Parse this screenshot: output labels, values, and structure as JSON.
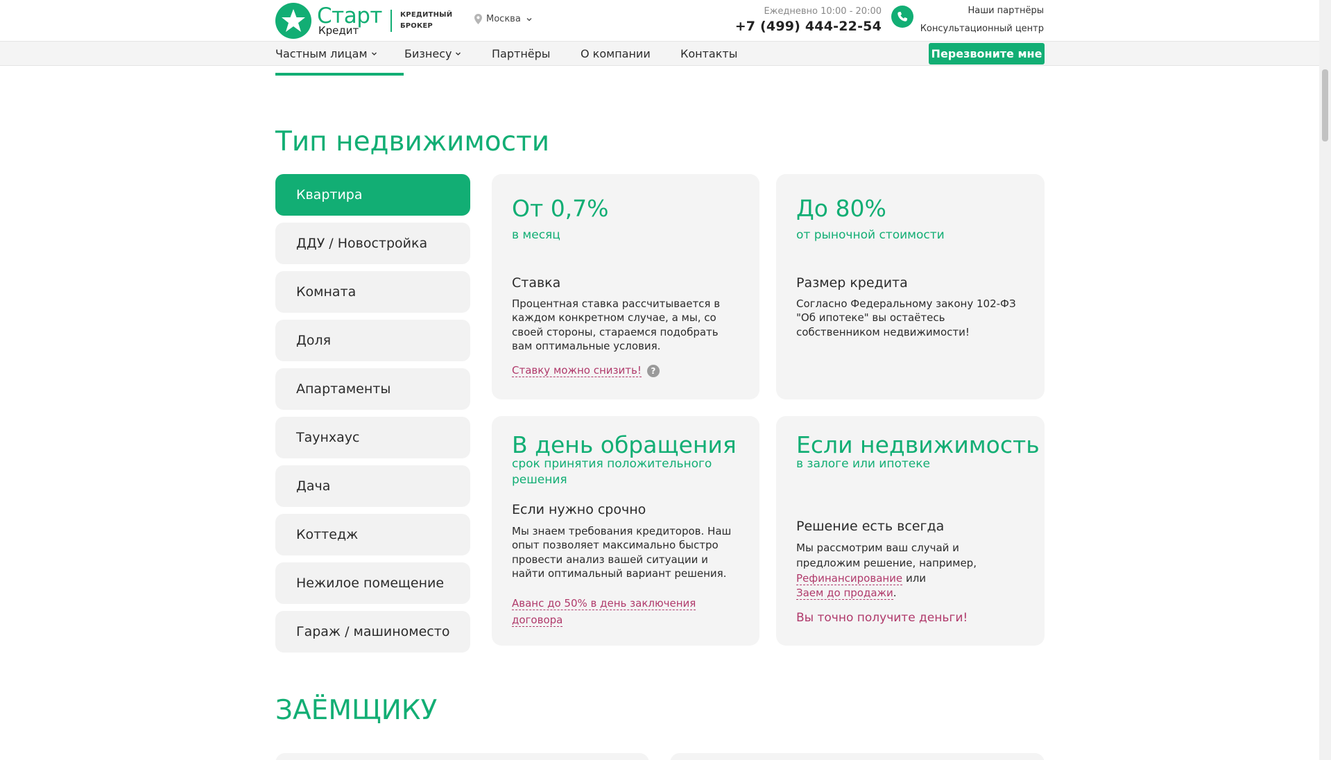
{
  "header": {
    "logo": {
      "name": "Старт",
      "sub_name": "Кредит",
      "tagline_line1": "КРЕДИТНЫЙ",
      "tagline_line2": "БРОКЕР"
    },
    "city": "Москва",
    "schedule": "Ежедневно 10:00 - 20:00",
    "phone": "+7 (499) 444-22-54",
    "partners_link": "Наши партнёры",
    "consult_link": "Консультационный центр"
  },
  "nav": {
    "items": [
      {
        "label": "Частным лицам",
        "dropdown": true
      },
      {
        "label": "Бизнесу",
        "dropdown": true
      },
      {
        "label": "Партнёры",
        "dropdown": false
      },
      {
        "label": "О компании",
        "dropdown": false
      },
      {
        "label": "Контакты",
        "dropdown": false
      }
    ],
    "callback_button": "Перезвоните мне"
  },
  "property_section": {
    "title": "Тип недвижимости",
    "types": [
      "Квартира",
      "ДДУ / Новостройка",
      "Комната",
      "Доля",
      "Апартаменты",
      "Таунхаус",
      "Дача",
      "Коттедж",
      "Нежилое помещение",
      "Гараж / машиноместо"
    ],
    "active_index": 0,
    "cards": {
      "rate": {
        "big": "От 0,7%",
        "sub": "в месяц",
        "heading": "Ставка",
        "text": "Процентная ставка рассчитывается в каждом конкретном случае, а мы, со своей стороны, стараемся подобрать вам оптимальные условия.",
        "link": "Ставку можно снизить!",
        "help": "?"
      },
      "size": {
        "big": "До 80%",
        "sub": "от рыночной стоимости",
        "heading": "Размер кредита",
        "text": "Согласно Федеральному закону 102-ФЗ \"Об ипотеке\" вы остаётесь собственником недвижимости!"
      },
      "speed": {
        "big": "В день обращения",
        "sub": "срок принятия положительного решения",
        "heading": "Если нужно срочно",
        "text": "Мы знаем требования кредиторов. Наш опыт позволяет максимально быстро провести анализ вашей ситуации и найти оптимальный вариант решения.",
        "link": "Аванс до 50% в день заключения договора"
      },
      "pledge": {
        "big": "Если недвижимость",
        "sub": "в залоге или ипотеке",
        "heading": "Решение есть всегда",
        "text_before": "Мы рассмотрим ваш случай и предложим решение, например,",
        "link1": "Рефинансирование",
        "text_middle": "или",
        "link2": "Заем до продажи",
        "text_end": ".",
        "cta": "Вы точно получите деньги!"
      }
    }
  },
  "borrower_section": {
    "title": "ЗАЁМЩИКУ"
  },
  "colors": {
    "brand_green": "#12ae74",
    "link_pink": "#b03a6b",
    "card_bg": "#f4f4f4"
  }
}
